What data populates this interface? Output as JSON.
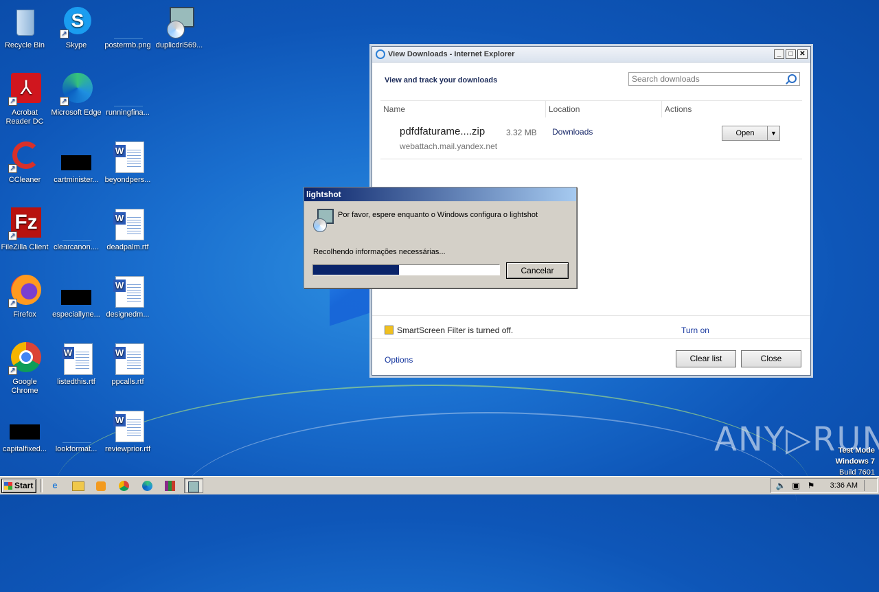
{
  "desktop": {
    "icons": [
      {
        "label": "Recycle Bin",
        "icon": "recycle-bin-icon"
      },
      {
        "label": "Skype",
        "icon": "skype-icon"
      },
      {
        "label": "postermb.png",
        "icon": "image-file-icon"
      },
      {
        "label": "duplicdri569...",
        "icon": "installer-icon"
      },
      {
        "label": "Acrobat Reader DC",
        "icon": "acrobat-icon"
      },
      {
        "label": "Microsoft Edge",
        "icon": "edge-icon"
      },
      {
        "label": "runningfina...",
        "icon": "file-icon"
      },
      {
        "label": "CCleaner",
        "icon": "ccleaner-icon"
      },
      {
        "label": "cartminister...",
        "icon": "file-icon"
      },
      {
        "label": "beyondpers...",
        "icon": "word-doc-icon"
      },
      {
        "label": "FileZilla Client",
        "icon": "filezilla-icon"
      },
      {
        "label": "clearcanon....",
        "icon": "file-icon"
      },
      {
        "label": "deadpalm.rtf",
        "icon": "word-doc-icon"
      },
      {
        "label": "Firefox",
        "icon": "firefox-icon"
      },
      {
        "label": "especiallyne...",
        "icon": "file-icon"
      },
      {
        "label": "designedm...",
        "icon": "word-doc-icon"
      },
      {
        "label": "Google Chrome",
        "icon": "chrome-icon"
      },
      {
        "label": "listedthis.rtf",
        "icon": "word-doc-icon"
      },
      {
        "label": "ppcalls.rtf",
        "icon": "word-doc-icon"
      },
      {
        "label": "capitalfixed...",
        "icon": "file-icon"
      },
      {
        "label": "lookformat...",
        "icon": "file-icon"
      },
      {
        "label": "reviewprior.rtf",
        "icon": "word-doc-icon"
      }
    ]
  },
  "ie_downloads": {
    "title": "View Downloads - Internet Explorer",
    "heading": "View and track your downloads",
    "search_placeholder": "Search downloads",
    "columns": [
      "Name",
      "Location",
      "Actions"
    ],
    "item": {
      "name": "pdfdfaturame....zip",
      "size": "3.32 MB",
      "source": "webattach.mail.yandex.net",
      "location": "Downloads",
      "action": "Open"
    },
    "smartscreen": "SmartScreen Filter is turned off.",
    "turn_on": "Turn on",
    "options": "Options",
    "clear_list": "Clear list",
    "close": "Close"
  },
  "lightshot_dialog": {
    "title": "lightshot",
    "message": "Por favor, espere enquanto o Windows configura o lightshot",
    "status": "Recolhendo informações necessárias...",
    "progress": 0.46,
    "cancel": "Cancelar"
  },
  "watermark": {
    "brand": "ANY▷RUN",
    "test_mode": "Test Mode",
    "os": "Windows 7",
    "build": "Build 7601"
  },
  "taskbar": {
    "start": "Start",
    "clock": "3:36 AM"
  }
}
